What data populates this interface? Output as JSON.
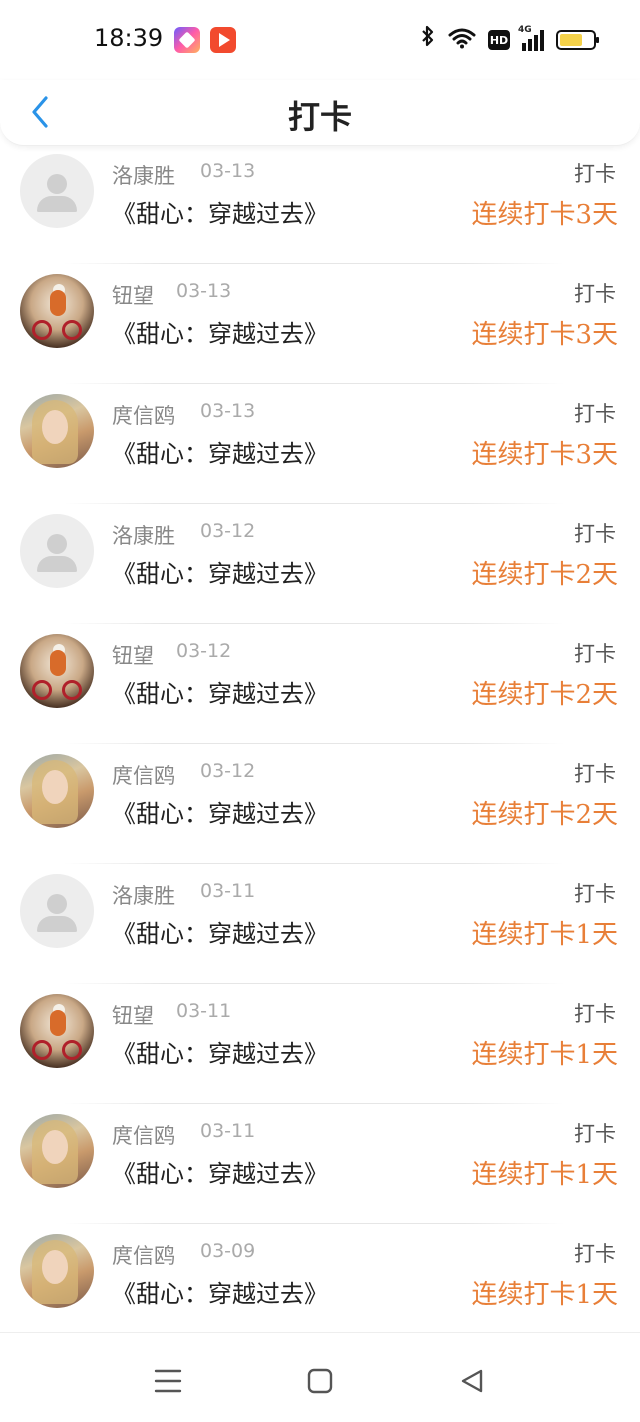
{
  "status_bar": {
    "time": "18:39",
    "bluetooth_icon": "✱",
    "wifi_icon": "wifi",
    "hd_label": "HD",
    "network_label": "4G",
    "battery_level": 0.7,
    "battery_color": "#f5d24a"
  },
  "header": {
    "title": "打卡",
    "back_color": "#2a93e8"
  },
  "accent_color": "#e87f38",
  "list": [
    {
      "name": "洛康胜",
      "date": "03-13",
      "book": "《甜心：穿越过去》",
      "type": "打卡",
      "streak": "连续打卡3天",
      "avatar": "default"
    },
    {
      "name": "钮望",
      "date": "03-13",
      "book": "《甜心：穿越过去》",
      "type": "打卡",
      "streak": "连续打卡3天",
      "avatar": "bike"
    },
    {
      "name": "庹信鸥",
      "date": "03-13",
      "book": "《甜心：穿越过去》",
      "type": "打卡",
      "streak": "连续打卡3天",
      "avatar": "girl"
    },
    {
      "name": "洛康胜",
      "date": "03-12",
      "book": "《甜心：穿越过去》",
      "type": "打卡",
      "streak": "连续打卡2天",
      "avatar": "default"
    },
    {
      "name": "钮望",
      "date": "03-12",
      "book": "《甜心：穿越过去》",
      "type": "打卡",
      "streak": "连续打卡2天",
      "avatar": "bike"
    },
    {
      "name": "庹信鸥",
      "date": "03-12",
      "book": "《甜心：穿越过去》",
      "type": "打卡",
      "streak": "连续打卡2天",
      "avatar": "girl"
    },
    {
      "name": "洛康胜",
      "date": "03-11",
      "book": "《甜心：穿越过去》",
      "type": "打卡",
      "streak": "连续打卡1天",
      "avatar": "default"
    },
    {
      "name": "钮望",
      "date": "03-11",
      "book": "《甜心：穿越过去》",
      "type": "打卡",
      "streak": "连续打卡1天",
      "avatar": "bike"
    },
    {
      "name": "庹信鸥",
      "date": "03-11",
      "book": "《甜心：穿越过去》",
      "type": "打卡",
      "streak": "连续打卡1天",
      "avatar": "girl"
    },
    {
      "name": "庹信鸥",
      "date": "03-09",
      "book": "《甜心：穿越过去》",
      "type": "打卡",
      "streak": "连续打卡1天",
      "avatar": "girl"
    }
  ],
  "nav_bar": {
    "menu_icon": "menu-icon",
    "home_icon": "square-icon",
    "back_icon": "triangle-back-icon"
  }
}
